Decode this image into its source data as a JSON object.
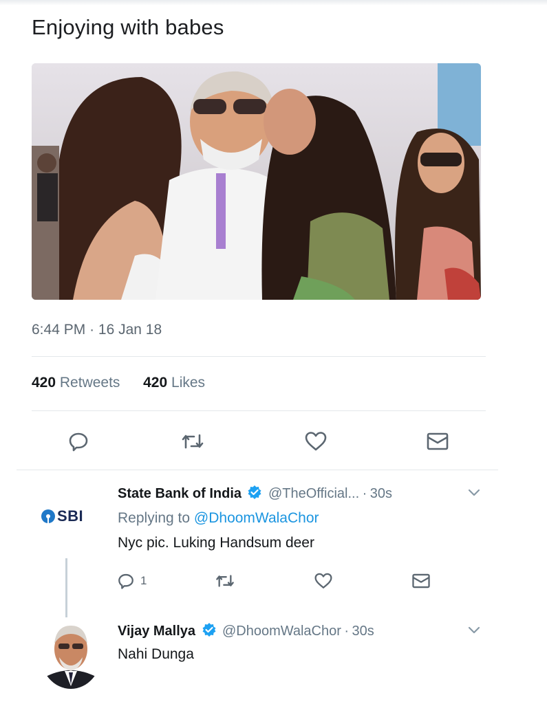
{
  "tweet": {
    "text": "Enjoying with babes",
    "time": "6:44 PM",
    "separator": "·",
    "date": "16 Jan 18",
    "retweets_count": "420",
    "retweets_label": "Retweets",
    "likes_count": "420",
    "likes_label": "Likes"
  },
  "replies": [
    {
      "name": "State Bank of India",
      "handle": "@TheOfficial...",
      "time_sep": "·",
      "time": "30s",
      "avatar_text": "SBI",
      "replying_prefix": "Replying to",
      "replying_to": "@DhoomWalaChor",
      "text": "Nyc pic. Luking Handsum deer",
      "reply_count": "1"
    },
    {
      "name": "Vijay Mallya",
      "handle": "@DhoomWalaChor",
      "time_sep": "·",
      "time": "30s",
      "text": "Nahi Dunga"
    }
  ],
  "colors": {
    "verified": "#1da1f2",
    "icon": "#5b6670",
    "mention": "#1b95e0"
  }
}
